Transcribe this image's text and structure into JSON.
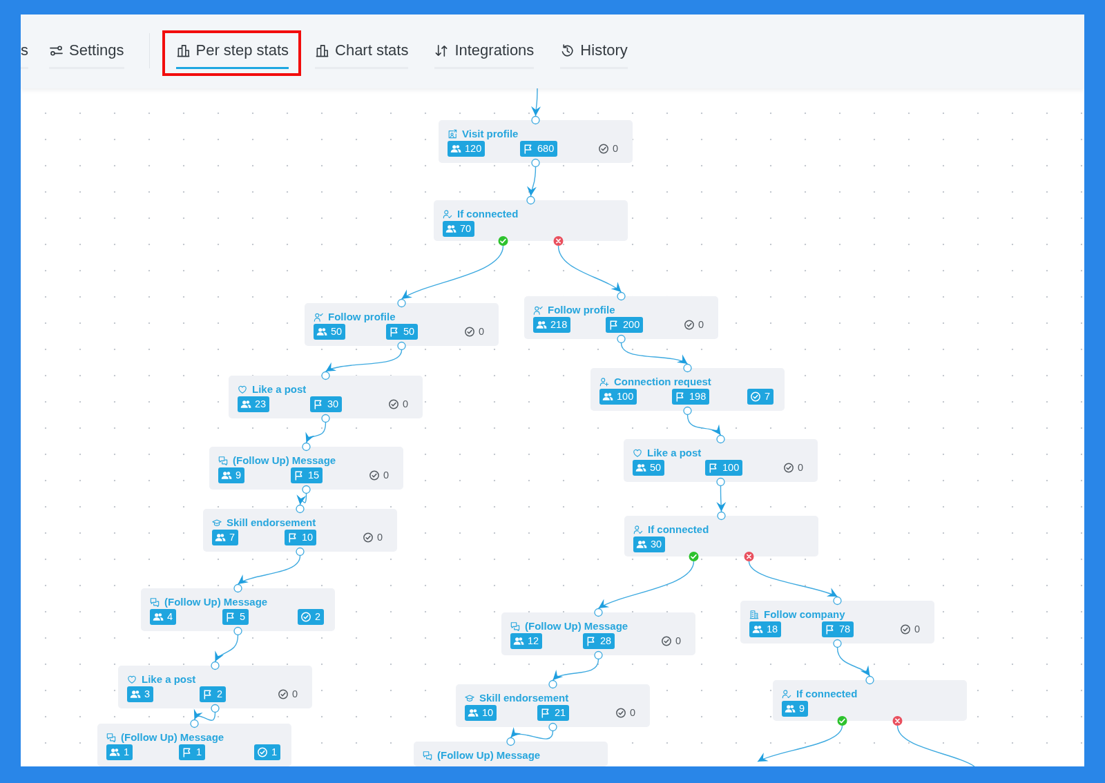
{
  "tab_groups": [
    {
      "tabs": [
        {
          "kind": "text",
          "label": "s",
          "selected": false,
          "highlighted": false
        },
        {
          "kind": "settings",
          "label": "Settings",
          "selected": false,
          "highlighted": false
        }
      ]
    },
    {
      "tabs": [
        {
          "kind": "stats",
          "label": "Per step stats",
          "selected": true,
          "highlighted": true
        },
        {
          "kind": "chart",
          "label": "Chart stats",
          "selected": false,
          "highlighted": false
        },
        {
          "kind": "integrations",
          "label": "Integrations",
          "selected": false,
          "highlighted": false
        },
        {
          "kind": "history",
          "label": "History",
          "selected": false,
          "highlighted": false
        }
      ]
    }
  ],
  "flow": {
    "incoming_edge": true,
    "start": {
      "kind": "visit",
      "title": "Visit profile",
      "stats": [
        {
          "kind": "contacts",
          "value": "120",
          "filled": true
        },
        {
          "kind": "flags",
          "value": "680",
          "filled": true
        },
        {
          "kind": "completed",
          "value": "0",
          "filled": false
        }
      ],
      "next": {
        "kind": "condition",
        "title": "If connected",
        "stats": [
          {
            "kind": "contacts",
            "value": "70",
            "filled": true
          }
        ],
        "branches": [
          {
            "kind": "yes",
            "step": {
              "kind": "follow",
              "title": "Follow profile",
              "stats": [
                {
                  "kind": "contacts",
                  "value": "50",
                  "filled": true
                },
                {
                  "kind": "flags",
                  "value": "50",
                  "filled": true
                },
                {
                  "kind": "completed",
                  "value": "0",
                  "filled": false
                }
              ],
              "next": {
                "kind": "like",
                "title": "Like a post",
                "stats": [
                  {
                    "kind": "contacts",
                    "value": "23",
                    "filled": true
                  },
                  {
                    "kind": "flags",
                    "value": "30",
                    "filled": true
                  },
                  {
                    "kind": "completed",
                    "value": "0",
                    "filled": false
                  }
                ],
                "next": {
                  "kind": "message",
                  "title": "(Follow Up) Message",
                  "stats": [
                    {
                      "kind": "contacts",
                      "value": "9",
                      "filled": true
                    },
                    {
                      "kind": "flags",
                      "value": "15",
                      "filled": true
                    },
                    {
                      "kind": "completed",
                      "value": "0",
                      "filled": false
                    }
                  ],
                  "next": {
                    "kind": "endorse",
                    "title": "Skill endorsement",
                    "stats": [
                      {
                        "kind": "contacts",
                        "value": "7",
                        "filled": true
                      },
                      {
                        "kind": "flags",
                        "value": "10",
                        "filled": true
                      },
                      {
                        "kind": "completed",
                        "value": "0",
                        "filled": false
                      }
                    ],
                    "next": {
                      "kind": "message",
                      "title": "(Follow Up) Message",
                      "stats": [
                        {
                          "kind": "contacts",
                          "value": "4",
                          "filled": true
                        },
                        {
                          "kind": "flags",
                          "value": "5",
                          "filled": true
                        },
                        {
                          "kind": "completed",
                          "value": "2",
                          "filled": true
                        }
                      ],
                      "next": {
                        "kind": "like",
                        "title": "Like a post",
                        "stats": [
                          {
                            "kind": "contacts",
                            "value": "3",
                            "filled": true
                          },
                          {
                            "kind": "flags",
                            "value": "2",
                            "filled": true
                          },
                          {
                            "kind": "completed",
                            "value": "0",
                            "filled": false
                          }
                        ],
                        "next": {
                          "kind": "message",
                          "title": "(Follow Up) Message",
                          "stats": [
                            {
                              "kind": "contacts",
                              "value": "1",
                              "filled": true
                            },
                            {
                              "kind": "flags",
                              "value": "1",
                              "filled": true
                            },
                            {
                              "kind": "completed",
                              "value": "1",
                              "filled": true
                            }
                          ]
                        }
                      }
                    }
                  }
                }
              }
            }
          },
          {
            "kind": "no",
            "step": {
              "kind": "follow",
              "title": "Follow profile",
              "stats": [
                {
                  "kind": "contacts",
                  "value": "218",
                  "filled": true
                },
                {
                  "kind": "flags",
                  "value": "200",
                  "filled": true
                },
                {
                  "kind": "completed",
                  "value": "0",
                  "filled": false
                }
              ],
              "next": {
                "kind": "connect",
                "title": "Connection request",
                "stats": [
                  {
                    "kind": "contacts",
                    "value": "100",
                    "filled": true
                  },
                  {
                    "kind": "flags",
                    "value": "198",
                    "filled": true
                  },
                  {
                    "kind": "completed",
                    "value": "7",
                    "filled": true
                  }
                ],
                "next": {
                  "kind": "like",
                  "title": "Like a post",
                  "stats": [
                    {
                      "kind": "contacts",
                      "value": "50",
                      "filled": true
                    },
                    {
                      "kind": "flags",
                      "value": "100",
                      "filled": true
                    },
                    {
                      "kind": "completed",
                      "value": "0",
                      "filled": false
                    }
                  ],
                  "next": {
                    "kind": "condition",
                    "title": "If connected",
                    "stats": [
                      {
                        "kind": "contacts",
                        "value": "30",
                        "filled": true
                      }
                    ],
                    "branches": [
                      {
                        "kind": "yes",
                        "step": {
                          "kind": "message",
                          "title": "(Follow Up) Message",
                          "stats": [
                            {
                              "kind": "contacts",
                              "value": "12",
                              "filled": true
                            },
                            {
                              "kind": "flags",
                              "value": "28",
                              "filled": true
                            },
                            {
                              "kind": "completed",
                              "value": "0",
                              "filled": false
                            }
                          ],
                          "next": {
                            "kind": "endorse",
                            "title": "Skill endorsement",
                            "stats": [
                              {
                                "kind": "contacts",
                                "value": "10",
                                "filled": true
                              },
                              {
                                "kind": "flags",
                                "value": "21",
                                "filled": true
                              },
                              {
                                "kind": "completed",
                                "value": "0",
                                "filled": false
                              }
                            ],
                            "next": {
                              "kind": "message",
                              "title": "(Follow Up) Message"
                            }
                          }
                        }
                      },
                      {
                        "kind": "no",
                        "step": {
                          "kind": "company",
                          "title": "Follow company",
                          "stats": [
                            {
                              "kind": "contacts",
                              "value": "18",
                              "filled": true
                            },
                            {
                              "kind": "flags",
                              "value": "78",
                              "filled": true
                            },
                            {
                              "kind": "completed",
                              "value": "0",
                              "filled": false
                            }
                          ],
                          "next": {
                            "kind": "condition",
                            "title": "If connected",
                            "stats": [
                              {
                                "kind": "contacts",
                                "value": "9",
                                "filled": true
                              }
                            ],
                            "branches": [
                              {
                                "kind": "yes"
                              },
                              {
                                "kind": "no"
                              }
                            ]
                          }
                        }
                      }
                    ]
                  }
                }
              }
            }
          }
        ]
      }
    }
  }
}
